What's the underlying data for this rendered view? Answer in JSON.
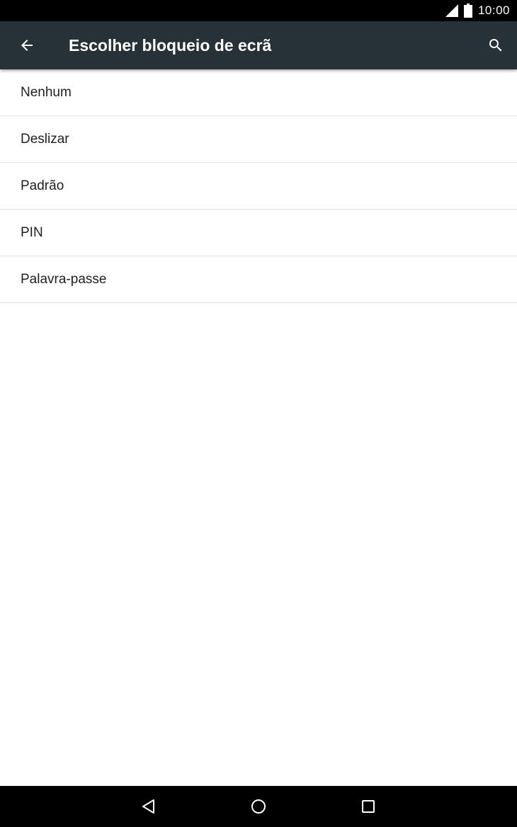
{
  "status_bar": {
    "time": "10:00",
    "icons": [
      "signal-icon",
      "battery-icon"
    ]
  },
  "app_bar": {
    "title": "Escolher bloqueio de ecrã",
    "background_color": "#263238",
    "icons": [
      "back-arrow-icon",
      "search-icon"
    ]
  },
  "lock_options": [
    {
      "label": "Nenhum"
    },
    {
      "label": "Deslizar"
    },
    {
      "label": "Padrão"
    },
    {
      "label": "PIN"
    },
    {
      "label": "Palavra-passe"
    }
  ],
  "nav_bar": {
    "icons": [
      "nav-back-icon",
      "nav-home-icon",
      "nav-recents-icon"
    ]
  }
}
